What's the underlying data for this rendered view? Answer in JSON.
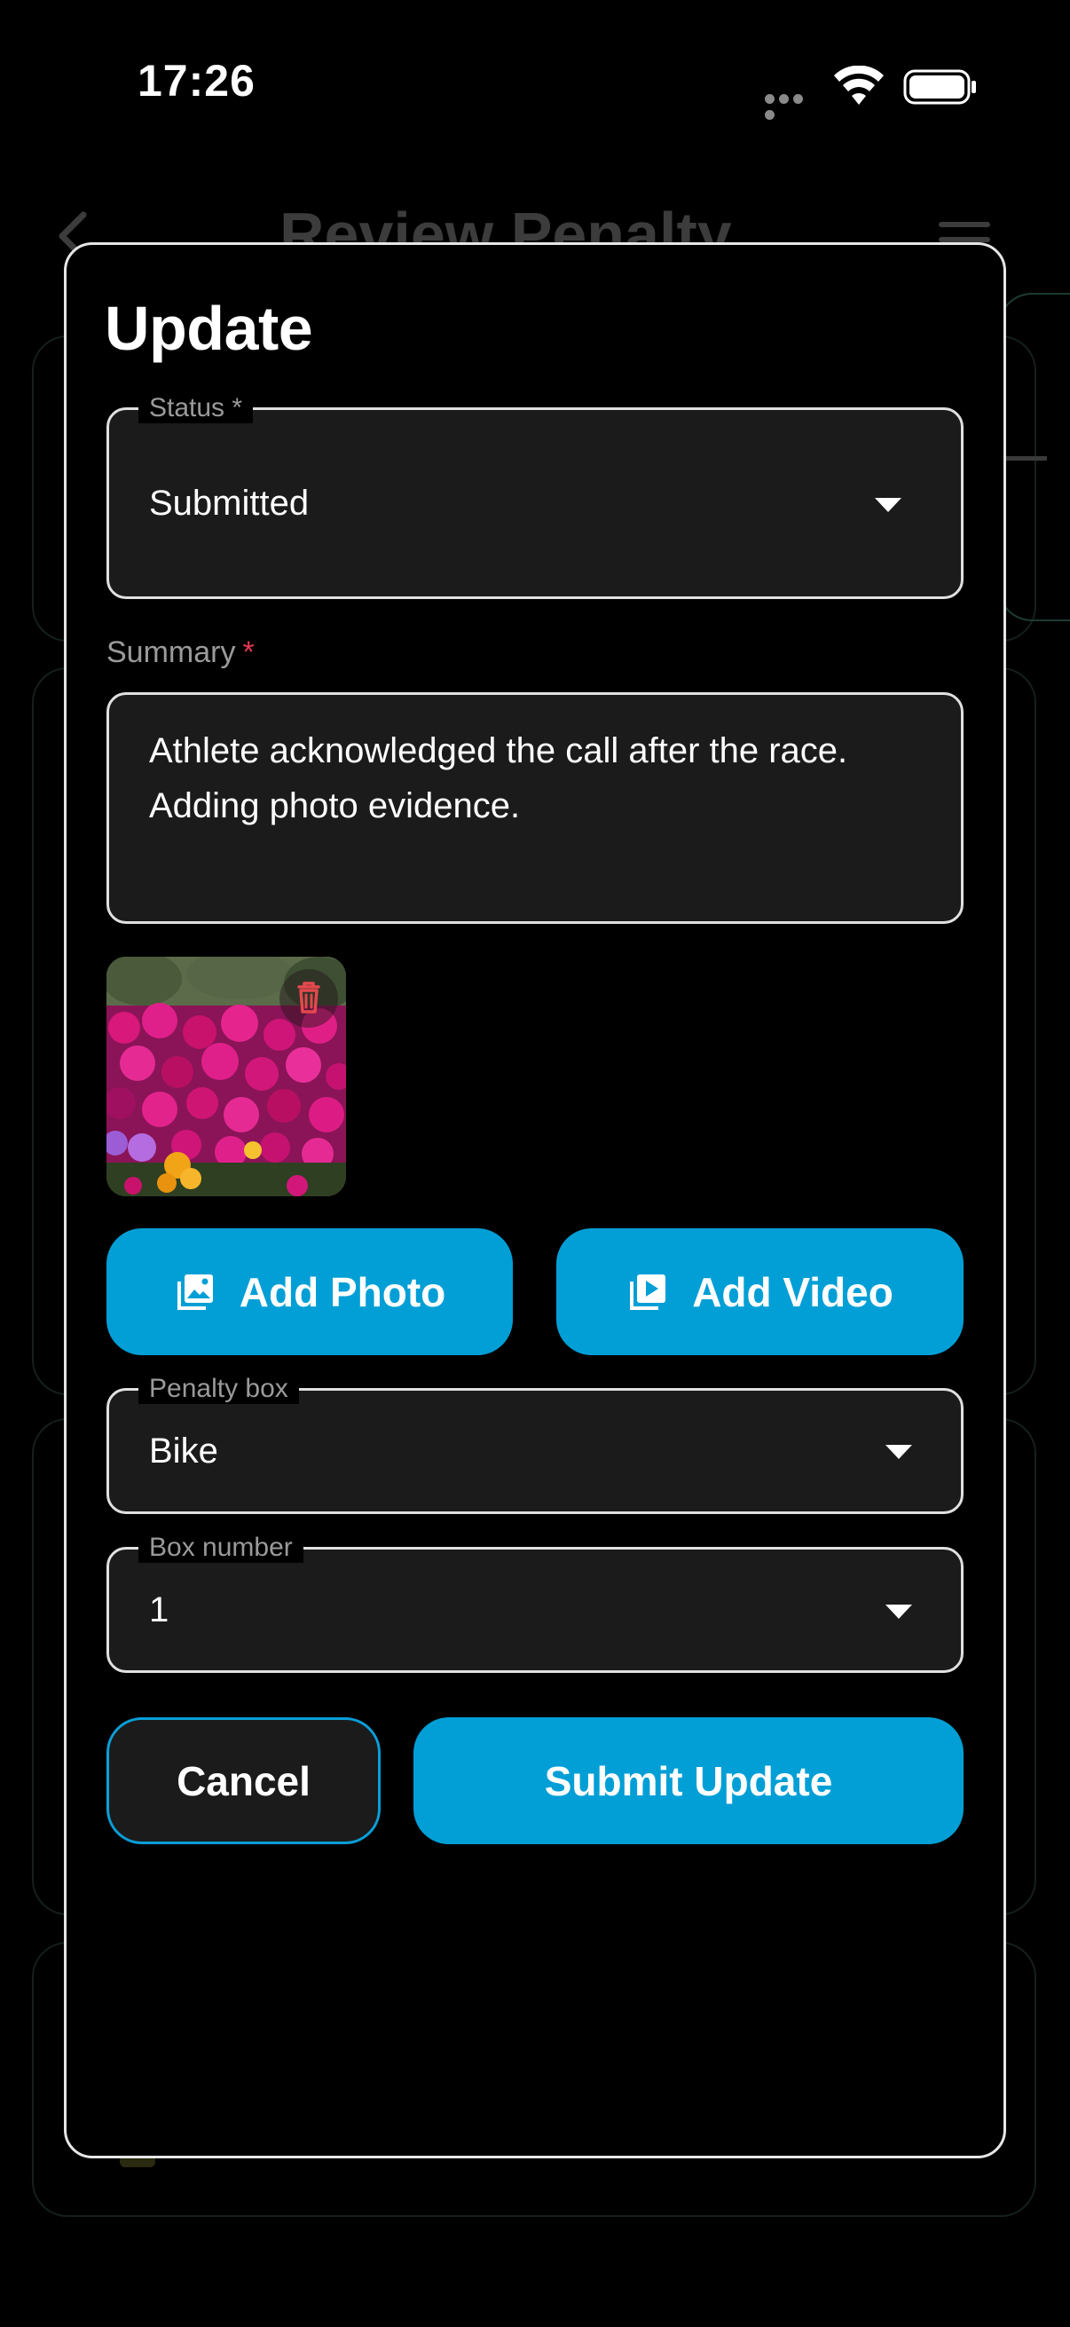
{
  "status_bar": {
    "time": "17:26"
  },
  "background": {
    "title": "Review Penalty"
  },
  "modal": {
    "title": "Update",
    "status": {
      "label": "Status *",
      "value": "Submitted"
    },
    "summary": {
      "label": "Summary",
      "required_mark": "*",
      "value": "Athlete acknowledged the call after the race. Adding photo evidence."
    },
    "attachment": {
      "type": "photo",
      "subject": "magenta flowers"
    },
    "add_photo_label": "Add Photo",
    "add_video_label": "Add Video",
    "penalty_box": {
      "label": "Penalty box",
      "value": "Bike"
    },
    "box_number": {
      "label": "Box number",
      "value": "1"
    },
    "cancel_label": "Cancel",
    "submit_label": "Submit Update"
  },
  "colors": {
    "accent": "#019fd6",
    "required": "#e53950",
    "trash": "#e5484d"
  },
  "icons": [
    "wifi-icon",
    "battery-icon",
    "back-chevron-icon",
    "menu-icon",
    "dropdown-caret-icon",
    "trash-icon",
    "add-photo-icon",
    "add-video-icon"
  ]
}
